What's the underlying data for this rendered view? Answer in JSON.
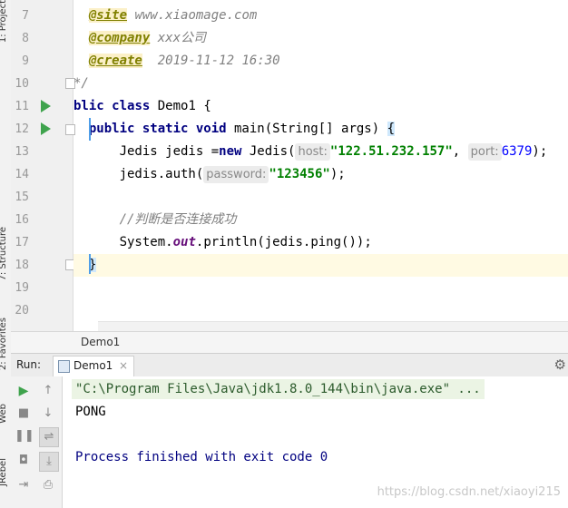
{
  "tool_strip": {
    "project_tab": "1: Project",
    "structure_tab": "7: Structure",
    "favorites_tab": "2: Favorites",
    "web_tab": "Web",
    "jrebel_tab": "JRebel"
  },
  "editor": {
    "line_numbers": [
      "7",
      "8",
      "9",
      "10",
      "11",
      "12",
      "13",
      "14",
      "15",
      "16",
      "17",
      "18",
      "19",
      "20"
    ],
    "javadoc": {
      "site_tag": "@site",
      "site_value": "www.xiaomage.com",
      "company_tag": "@company",
      "company_value": "xxx公司",
      "create_tag": "@create",
      "create_value": "2019-11-12 16:30",
      "close": "*/"
    },
    "class_line": {
      "public_kw": "blic",
      "class_kw": "class",
      "rest": " Demo1 {"
    },
    "main_line": {
      "modifiers": "public static void",
      "rest": " main(String[] args) ",
      "brace": "{"
    },
    "jedis_line": {
      "pre": "Jedis jedis =",
      "new_kw": "new",
      "ctor": " Jedis(",
      "host_hint": "host:",
      "host_value": "\"122.51.232.157\"",
      "comma": ",",
      "port_hint": "port:",
      "port_value": "6379",
      "end": ");"
    },
    "auth_line": {
      "pre": "jedis.auth(",
      "password_hint": "password:",
      "password_value": "\"123456\"",
      "end": ");"
    },
    "comment_line": "//判断是否连接成功",
    "println_line": {
      "pre": "System.",
      "out_field": "out",
      "rest": ".println(jedis.ping());"
    },
    "close_brace": "}"
  },
  "breadcrumb": {
    "item": "Demo1"
  },
  "run_panel": {
    "label": "Run:",
    "tab_label": "Demo1",
    "tab_close": "×",
    "settings_icon": "gear-icon",
    "console": {
      "command": "\"C:\\Program Files\\Java\\jdk1.8.0_144\\bin\\java.exe\" ...",
      "output": "PONG",
      "exit": "Process finished with exit code 0"
    }
  },
  "watermark": "https://blog.csdn.net/xiaoyi215",
  "colors": {
    "keyword": "#000080",
    "string": "#008000",
    "number": "#0000ff",
    "doc_tag": "#808000",
    "run_green": "#3fa34d",
    "current_line": "#fffae3"
  }
}
